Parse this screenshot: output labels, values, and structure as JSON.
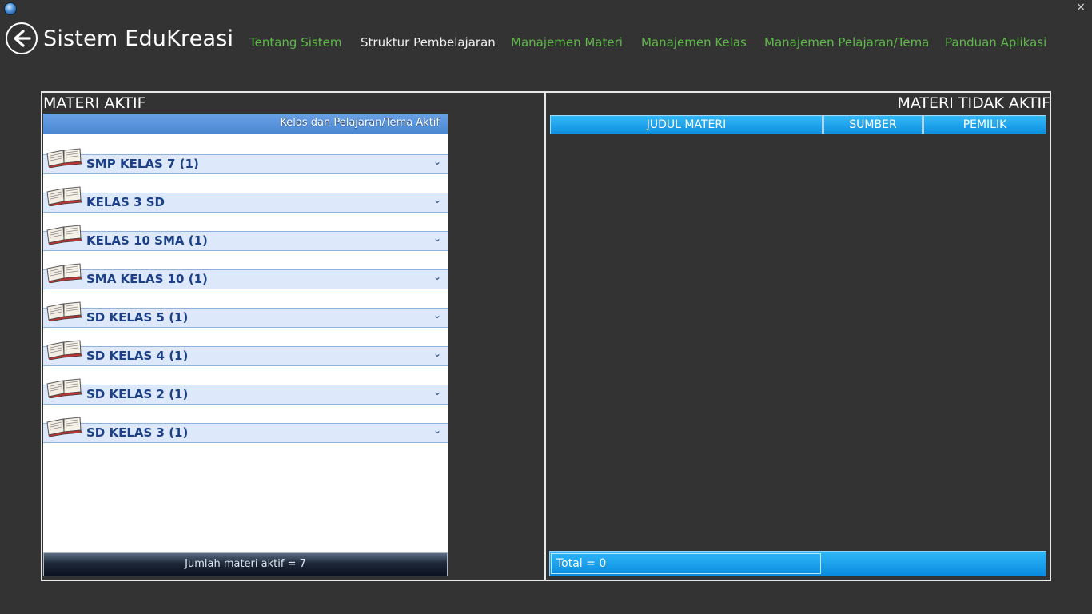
{
  "window": {
    "close_label": "×"
  },
  "header": {
    "title": "Sistem EduKreasi"
  },
  "nav": {
    "items": [
      {
        "label": "Tentang Sistem"
      },
      {
        "label": "Struktur Pembelajaran"
      },
      {
        "label": "Manajemen Materi"
      },
      {
        "label": "Manajemen Kelas"
      },
      {
        "label": "Manajemen Pelajaran/Tema"
      },
      {
        "label": "Panduan Aplikasi"
      }
    ],
    "active_item": "Struktur Pembelajaran"
  },
  "left": {
    "title": "MATERI AKTIF",
    "header_label": "Kelas dan Pelajaran/Tema Aktif",
    "groups": [
      {
        "label": "SMP KELAS 7 (1)"
      },
      {
        "label": "KELAS 3 SD"
      },
      {
        "label": "KELAS 10 SMA (1)"
      },
      {
        "label": "SMA KELAS 10 (1)"
      },
      {
        "label": "SD KELAS 5 (1)"
      },
      {
        "label": "SD KELAS 4 (1)"
      },
      {
        "label": "SD KELAS 2 (1)"
      },
      {
        "label": "SD KELAS 3 (1)"
      }
    ],
    "footer": "Jumlah materi aktif = 7"
  },
  "right": {
    "title": "MATERI TIDAK AKTIF",
    "columns": [
      "JUDUL MATERI",
      "SUMBER",
      "PEMILIK"
    ],
    "total": "Total = 0"
  },
  "colors": {
    "background": "#333333",
    "nav_link": "#5fb84a",
    "group_text": "#1c3f86",
    "table_header": "#0d8fe0"
  },
  "icons": {
    "app": "app-globe-icon",
    "back": "back-arrow-icon",
    "group": "book-icon",
    "expand": "chevron-down-icon"
  }
}
